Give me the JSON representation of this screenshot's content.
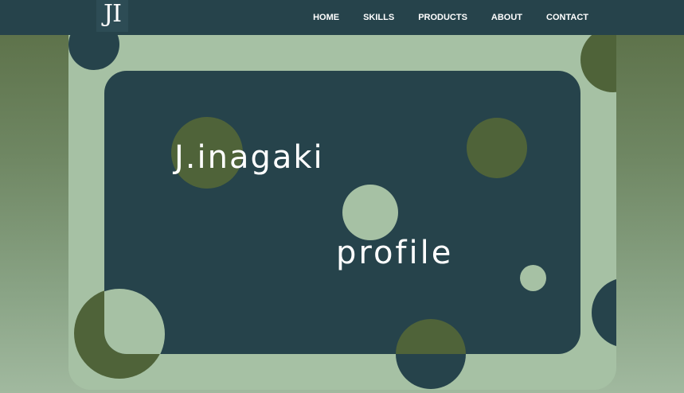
{
  "header": {
    "logo_text": "JI",
    "nav": [
      "HOME",
      "SKILLS",
      "PRODUCTS",
      "ABOUT",
      "CONTACT"
    ]
  },
  "hero": {
    "name": "J.inagaki",
    "subtitle": "profile"
  },
  "colors": {
    "dark_teal": "#26434b",
    "sage": "#a6c1a4",
    "olive": "#4f6339"
  }
}
